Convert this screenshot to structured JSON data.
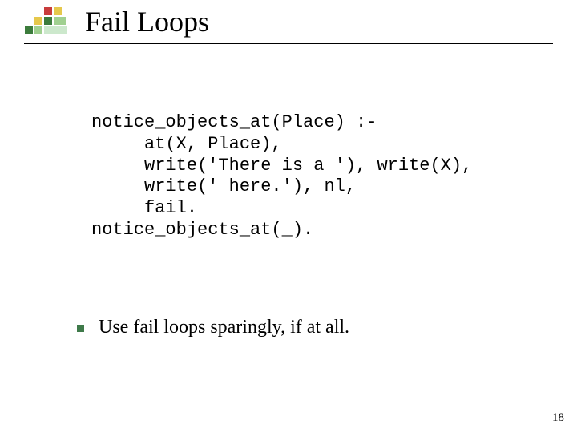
{
  "title": "Fail Loops",
  "code": "notice_objects_at(Place) :-\n     at(X, Place),\n     write('There is a '), write(X),\n     write(' here.'), nl,\n     fail.\nnotice_objects_at(_).",
  "bullet": "Use fail loops sparingly, if at all.",
  "page_number": "18"
}
